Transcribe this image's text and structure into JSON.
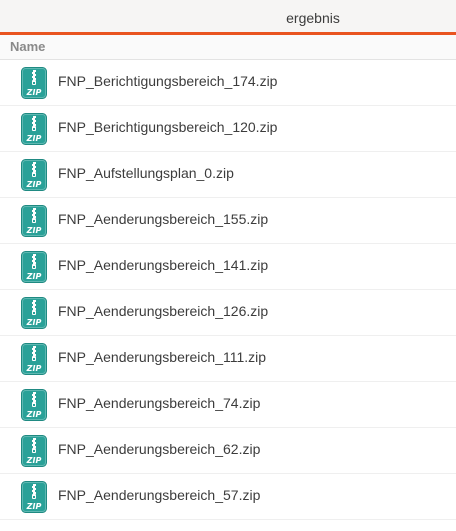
{
  "tab": {
    "title": "ergebnis"
  },
  "colors": {
    "accent": "#e95420",
    "zip_icon": "#2aa198"
  },
  "columns": {
    "name": "Name"
  },
  "files": [
    {
      "name": "FNP_Berichtigungsbereich_174.zip",
      "icon": "zip-archive-icon"
    },
    {
      "name": "FNP_Berichtigungsbereich_120.zip",
      "icon": "zip-archive-icon"
    },
    {
      "name": "FNP_Aufstellungsplan_0.zip",
      "icon": "zip-archive-icon"
    },
    {
      "name": "FNP_Aenderungsbereich_155.zip",
      "icon": "zip-archive-icon"
    },
    {
      "name": "FNP_Aenderungsbereich_141.zip",
      "icon": "zip-archive-icon"
    },
    {
      "name": "FNP_Aenderungsbereich_126.zip",
      "icon": "zip-archive-icon"
    },
    {
      "name": "FNP_Aenderungsbereich_111.zip",
      "icon": "zip-archive-icon"
    },
    {
      "name": "FNP_Aenderungsbereich_74.zip",
      "icon": "zip-archive-icon"
    },
    {
      "name": "FNP_Aenderungsbereich_62.zip",
      "icon": "zip-archive-icon"
    },
    {
      "name": "FNP_Aenderungsbereich_57.zip",
      "icon": "zip-archive-icon"
    }
  ]
}
